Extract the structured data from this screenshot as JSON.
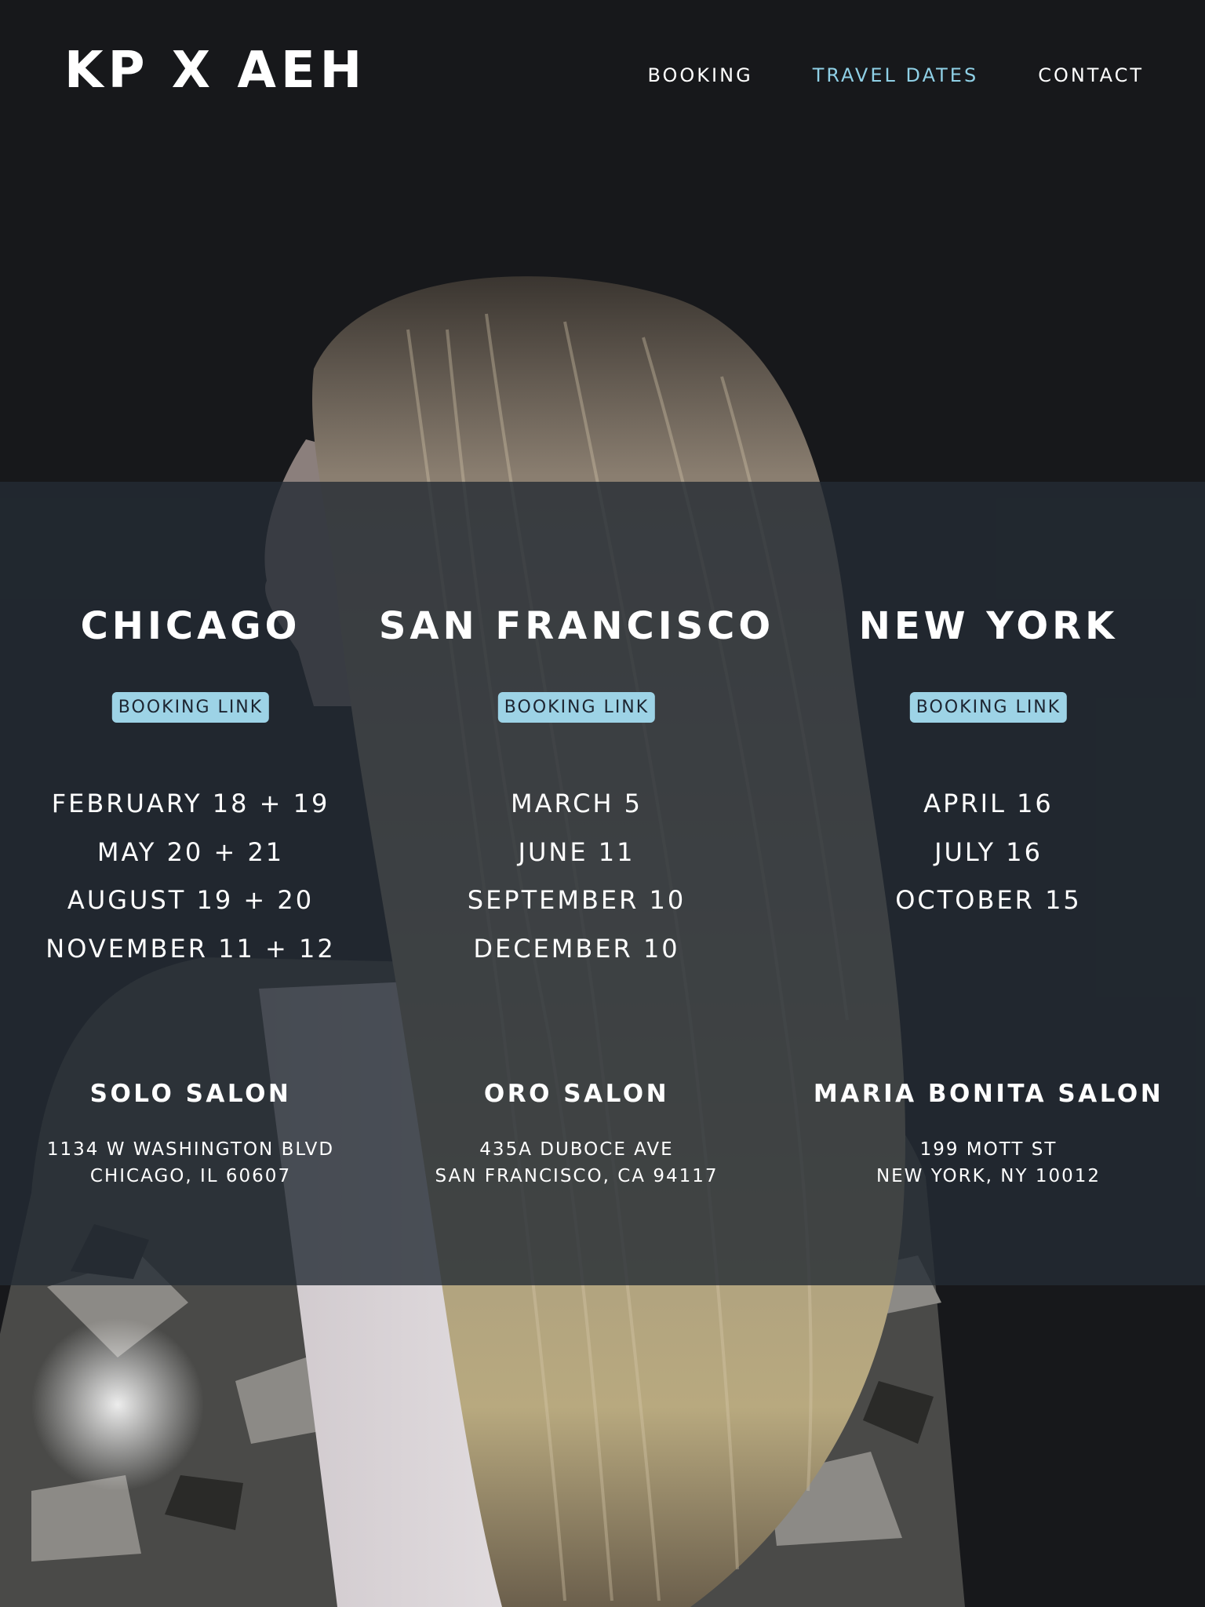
{
  "header": {
    "logo": "KP X AEH",
    "nav": [
      {
        "label": "BOOKING",
        "active": false
      },
      {
        "label": "TRAVEL DATES",
        "active": true
      },
      {
        "label": "CONTACT",
        "active": false
      }
    ]
  },
  "colors": {
    "background": "#17181b",
    "accent": "#8fd0e6",
    "button_bg": "#9dd3e6",
    "band": "#242c34"
  },
  "locations": [
    {
      "city": "CHICAGO",
      "booking_label": "BOOKING LINK",
      "dates": [
        "FEBRUARY 18 + 19",
        "MAY 20 + 21",
        "AUGUST 19 + 20",
        "NOVEMBER 11 + 12"
      ],
      "salon": "SOLO SALON",
      "address_line1": "1134 W WASHINGTON BLVD",
      "address_line2": "CHICAGO, IL 60607"
    },
    {
      "city": "SAN FRANCISCO",
      "booking_label": "BOOKING LINK",
      "dates": [
        "MARCH 5",
        "JUNE 11",
        "SEPTEMBER 10",
        "DECEMBER 10"
      ],
      "salon": "ORO SALON",
      "address_line1": "435A DUBOCE AVE",
      "address_line2": "SAN FRANCISCO, CA 94117"
    },
    {
      "city": "NEW YORK",
      "booking_label": "BOOKING LINK",
      "dates": [
        "APRIL 16",
        "JULY 16",
        "OCTOBER 15"
      ],
      "salon": "MARIA BONITA SALON",
      "address_line1": "199 MOTT ST",
      "address_line2": "NEW YORK, NY 10012"
    }
  ]
}
